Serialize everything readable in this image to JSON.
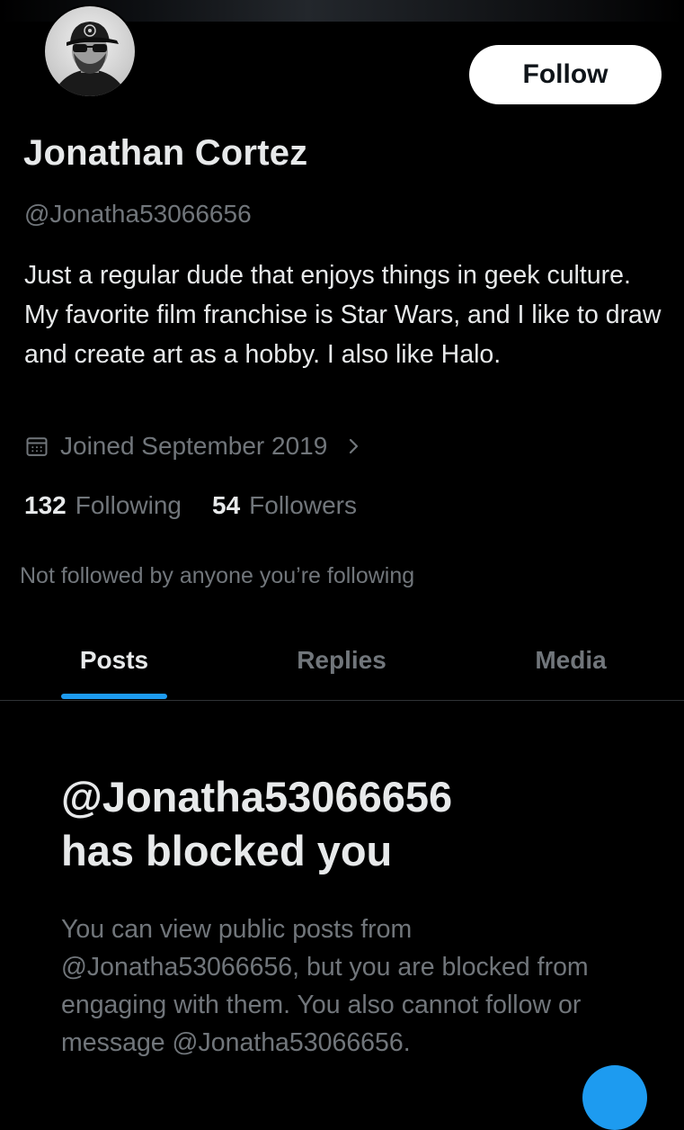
{
  "profile": {
    "display_name": "Jonathan Cortez",
    "handle": "@Jonatha53066656",
    "bio": "Just a regular dude that enjoys things in geek culture. My favorite film franchise is Star Wars, and I like to draw and create art as a hobby. I also like Halo.",
    "joined": "Joined September 2019",
    "following_count": "132",
    "following_label": "Following",
    "followers_count": "54",
    "followers_label": "Followers",
    "not_followed_text": "Not followed by anyone you’re following"
  },
  "actions": {
    "follow_label": "Follow"
  },
  "tabs": [
    {
      "label": "Posts",
      "active": true
    },
    {
      "label": "Replies",
      "active": false
    },
    {
      "label": "Media",
      "active": false
    }
  ],
  "blocked_notice": {
    "title_line1": "@Jonatha53066656",
    "title_line2": "has blocked you",
    "body": "You can view public posts from @Jonatha53066656, but you are blocked from engaging with them. You also cannot follow or message @Jonatha53066656."
  },
  "icons": {
    "joined": "calendar-icon",
    "joined_more": "chevron-right-icon"
  },
  "colors": {
    "background": "#000000",
    "primary_text": "#e7e9ea",
    "secondary_text": "#71767b",
    "accent": "#1d9bf0",
    "follow_button_bg": "#ffffff"
  }
}
